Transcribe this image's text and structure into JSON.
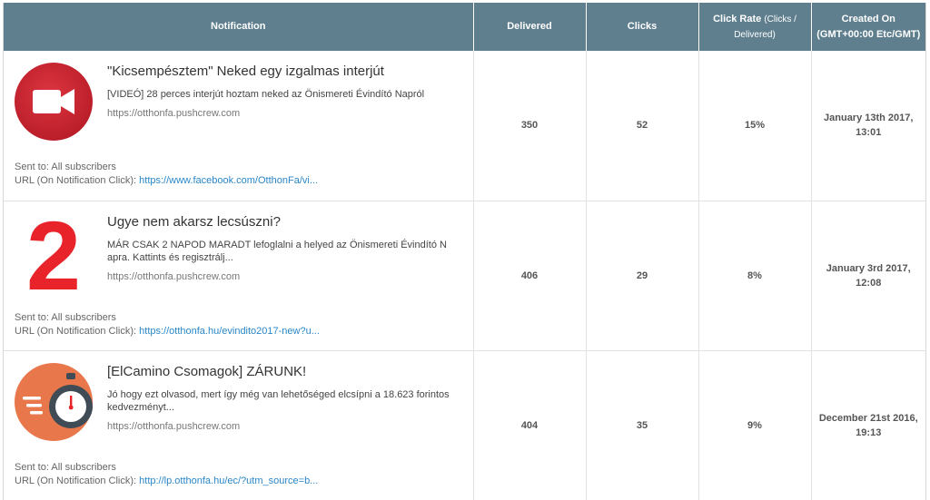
{
  "columns": {
    "notification": "Notification",
    "delivered": "Delivered",
    "clicks": "Clicks",
    "click_rate": "Click Rate",
    "click_rate_sub": "(Clicks / Delivered)",
    "created_on": "Created On (GMT+00:00 Etc/GMT)"
  },
  "labels": {
    "sent_to": "Sent to: All subscribers",
    "url_label": "URL (On Notification Click):"
  },
  "rows": [
    {
      "icon": "video-camera-icon",
      "title": "\"Kicsempésztem\" Neked egy izgalmas interjút",
      "body": "[VIDEÓ] 28 perces interjút hoztam neked az Önismereti Évindító Napról",
      "site": "https://otthonfa.pushcrew.com",
      "url": "https://www.facebook.com/OtthonFa/vi...",
      "delivered": "350",
      "clicks": "52",
      "rate": "15%",
      "created": "January 13th 2017, 13:01"
    },
    {
      "icon": "number-two-icon",
      "icon_text": "2",
      "title": "Ugye nem akarsz lecsúszni?",
      "body": "MÁR CSAK 2 NAPOD MARADT lefoglalni a helyed az Önismereti Évindító Napra. Kattints és regisztrálj...",
      "site": "https://otthonfa.pushcrew.com",
      "url": "https://otthonfa.hu/evindito2017-new?u...",
      "delivered": "406",
      "clicks": "29",
      "rate": "8%",
      "created": "January 3rd 2017, 12:08"
    },
    {
      "icon": "stopwatch-icon",
      "title": "[ElCamino Csomagok] ZÁRUNK!",
      "body": "Jó hogy ezt olvasod, mert így még van lehetőséged elcsípni a 18.623 forintos kedvezményt...",
      "site": "https://otthonfa.pushcrew.com",
      "url": "http://lp.otthonfa.hu/ec/?utm_source=b...",
      "delivered": "404",
      "clicks": "35",
      "rate": "9%",
      "created": "December 21st 2016, 19:13"
    }
  ],
  "colors": {
    "header_bg": "#5f7f8e",
    "video_icon_red": "#c8242f",
    "number_red": "#e8232a",
    "stopwatch_orange": "#e8774b",
    "link_blue": "#2a87c8"
  }
}
